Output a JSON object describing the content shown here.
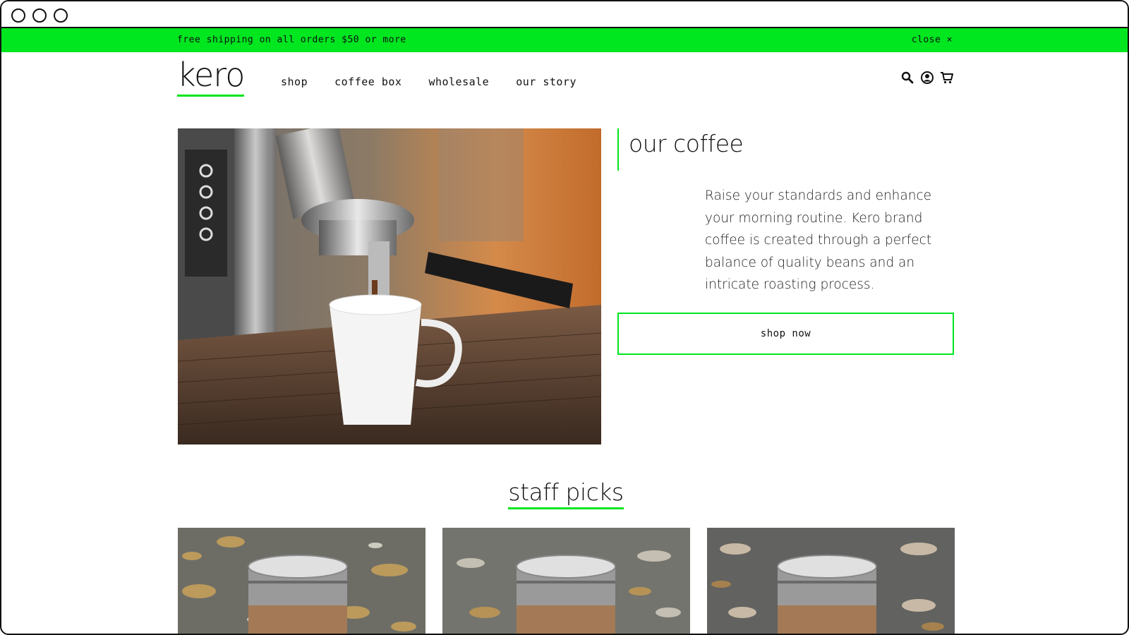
{
  "promo": {
    "message": "free shipping on all orders $50 or more",
    "close_label": "close ×"
  },
  "brand": {
    "logo": "kero",
    "accent": "#00e61f"
  },
  "nav": {
    "items": [
      "shop",
      "coffee box",
      "wholesale",
      "our story"
    ],
    "icons": [
      "search-icon",
      "account-icon",
      "cart-icon"
    ]
  },
  "hero": {
    "title": "our coffee",
    "body": "Raise your standards and enhance your morning routine. Kero brand coffee is created through a perfect balance of quality beans and an intricate roasting process.",
    "cta": "shop now"
  },
  "staff_picks": {
    "title": "staff picks",
    "products": [
      {
        "image": "coffee-canister-photo"
      },
      {
        "image": "coffee-canister-photo"
      },
      {
        "image": "coffee-canister-photo"
      }
    ]
  }
}
